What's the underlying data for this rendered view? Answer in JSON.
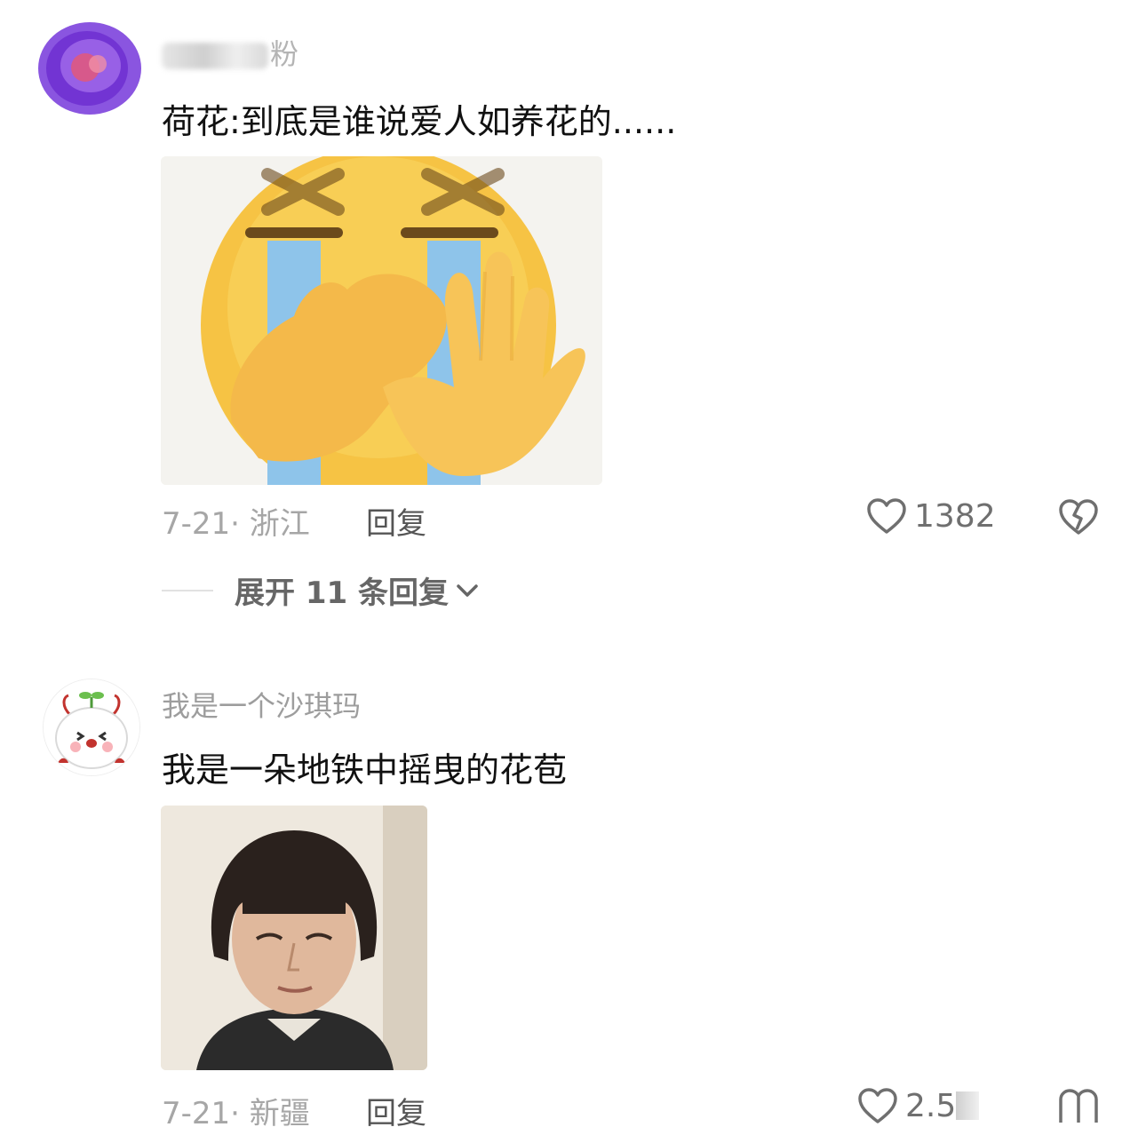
{
  "comments": [
    {
      "username_suffix": "粉",
      "text": "荷花:到底是谁说爱人如养花的......",
      "date_location": "7-21· 浙江",
      "reply_label": "回复",
      "likes": "1382",
      "expand_label": "展开 11 条回复",
      "icons": {
        "like": "heart-outline-icon",
        "dislike": "broken-heart-icon",
        "expand": "chevron-down-icon"
      }
    },
    {
      "username": "我是一个沙琪玛",
      "text": "我是一朵地铁中摇曳的花苞",
      "date_location": "7-21· 新疆",
      "reply_label": "回复",
      "likes": "2.5",
      "icons": {
        "like": "heart-outline-icon",
        "dislike": "broken-heart-icon"
      }
    }
  ],
  "colors": {
    "username": "#9d9d9d",
    "text": "#111111",
    "meta": "#a6a6a6",
    "emoji_yellow": "#f6c344",
    "avatar_purple": "#7a3fd6"
  }
}
